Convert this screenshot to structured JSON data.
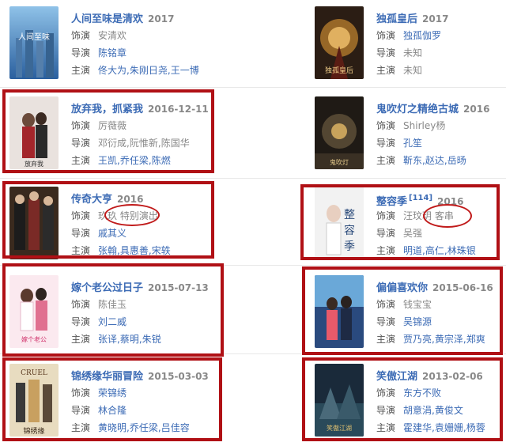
{
  "labels": {
    "actor": "饰演",
    "director": "导演",
    "starring": "主演"
  },
  "colors": {
    "link": "#3c6bb5",
    "highlight": "#b01015",
    "muted": "#888888"
  },
  "cards": [
    {
      "id": "c1",
      "title": "人间至味是清欢",
      "year": "2017",
      "badge": "",
      "role": [
        {
          "t": "安清欢",
          "link": false
        }
      ],
      "director": [
        {
          "t": "陈铭章",
          "link": true
        }
      ],
      "cast": [
        {
          "t": "佟大为",
          "link": true
        },
        {
          "t": "朱刚日尧",
          "link": true
        },
        {
          "t": "王一博",
          "link": true
        }
      ]
    },
    {
      "id": "c2",
      "title": "独孤皇后",
      "year": "2017",
      "badge": "",
      "role": [
        {
          "t": "独孤伽罗",
          "link": true
        }
      ],
      "director": [
        {
          "t": "未知",
          "link": false
        }
      ],
      "cast": [
        {
          "t": "未知",
          "link": false
        }
      ]
    },
    {
      "id": "c3",
      "title": "放弃我，抓紧我",
      "year": "2016-12-11",
      "badge": "",
      "role": [
        {
          "t": "厉薇薇",
          "link": false
        }
      ],
      "director": [
        {
          "t": "邓衍成",
          "link": false
        },
        {
          "t": "阮惟新",
          "link": false
        },
        {
          "t": "陈国华",
          "link": false
        }
      ],
      "cast": [
        {
          "t": "王凯",
          "link": true
        },
        {
          "t": "乔任梁",
          "link": true
        },
        {
          "t": "陈燃",
          "link": true
        }
      ]
    },
    {
      "id": "c4",
      "title": "鬼吹灯之精绝古城",
      "year": "2016",
      "badge": "",
      "role": [
        {
          "t": "Shirley杨",
          "link": false
        }
      ],
      "director": [
        {
          "t": "孔笙",
          "link": true
        }
      ],
      "cast": [
        {
          "t": "靳东",
          "link": true
        },
        {
          "t": "赵达",
          "link": true
        },
        {
          "t": "岳旸",
          "link": true
        }
      ]
    },
    {
      "id": "c5",
      "title": "传奇大亨",
      "year": "2016",
      "badge": "",
      "role": [
        {
          "t": "玖玖",
          "link": false
        },
        {
          "t": "特别演出",
          "link": false
        }
      ],
      "director": [
        {
          "t": "戚其义",
          "link": true
        }
      ],
      "cast": [
        {
          "t": "张翰",
          "link": true
        },
        {
          "t": "具惠善",
          "link": true
        },
        {
          "t": "宋轶",
          "link": true
        }
      ]
    },
    {
      "id": "c6",
      "title": "整容季",
      "year": "2016",
      "badge": "[114]",
      "role": [
        {
          "t": "汪玟玥",
          "link": false
        },
        {
          "t": "客串",
          "link": false
        }
      ],
      "director": [
        {
          "t": "吴强",
          "link": false
        }
      ],
      "cast": [
        {
          "t": "明道",
          "link": true
        },
        {
          "t": "高仁",
          "link": true
        },
        {
          "t": "林珠银",
          "link": true
        }
      ]
    },
    {
      "id": "c7",
      "title": "嫁个老公过日子",
      "year": "2015-07-13",
      "badge": "",
      "role": [
        {
          "t": "陈佳玉",
          "link": false
        }
      ],
      "director": [
        {
          "t": "刘二威",
          "link": true
        }
      ],
      "cast": [
        {
          "t": "张译",
          "link": true
        },
        {
          "t": "蔡明",
          "link": true
        },
        {
          "t": "朱锐",
          "link": true
        }
      ]
    },
    {
      "id": "c8",
      "title": "偏偏喜欢你",
      "year": "2015-06-16",
      "badge": "",
      "role": [
        {
          "t": "钱宝宝",
          "link": false
        }
      ],
      "director": [
        {
          "t": "吴锦源",
          "link": true
        }
      ],
      "cast": [
        {
          "t": "贾乃亮",
          "link": true
        },
        {
          "t": "黄宗泽",
          "link": true
        },
        {
          "t": "郑爽",
          "link": true
        }
      ]
    },
    {
      "id": "c9",
      "title": "锦绣缘华丽冒险",
      "year": "2015-03-03",
      "badge": "",
      "role": [
        {
          "t": "荣锦绣",
          "link": true
        }
      ],
      "director": [
        {
          "t": "林合隆",
          "link": true
        }
      ],
      "cast": [
        {
          "t": "黄晓明",
          "link": true
        },
        {
          "t": "乔任梁",
          "link": true
        },
        {
          "t": "吕佳容",
          "link": true
        }
      ]
    },
    {
      "id": "c10",
      "title": "笑傲江湖",
      "year": "2013-02-06",
      "badge": "",
      "role": [
        {
          "t": "东方不败",
          "link": true
        }
      ],
      "director": [
        {
          "t": "胡意涓",
          "link": true
        },
        {
          "t": "黄俊文",
          "link": true
        }
      ],
      "cast": [
        {
          "t": "霍建华",
          "link": true
        },
        {
          "t": "袁姗姗",
          "link": true
        },
        {
          "t": "杨蓉",
          "link": true
        }
      ]
    }
  ]
}
